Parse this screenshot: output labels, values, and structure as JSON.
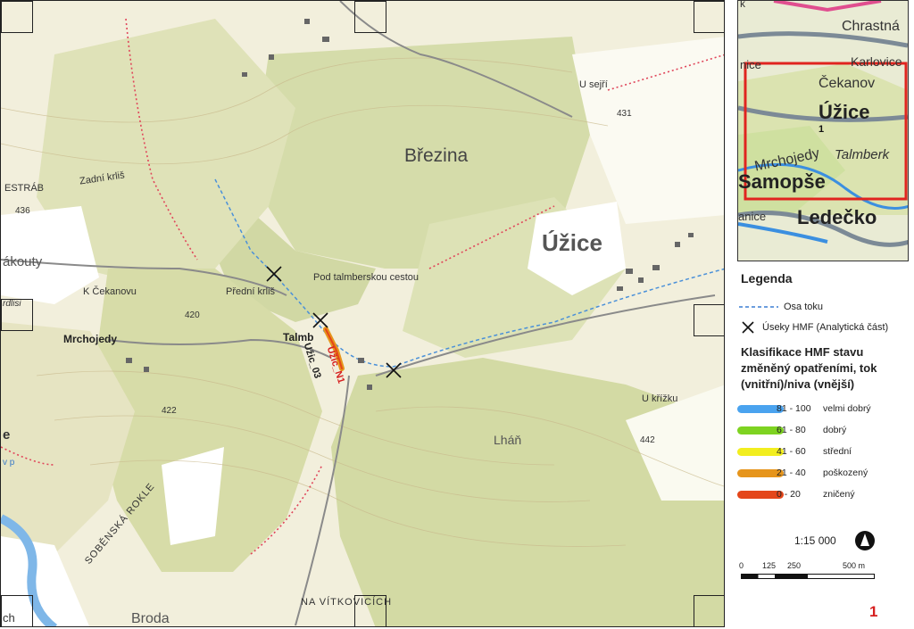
{
  "map": {
    "place_labels": {
      "brezina": "Březina",
      "uzice": "Úžice",
      "zadni_krlis": "Zadní krliš",
      "u_sejri": "U sejří",
      "pod_talmberskou": "Pod talmberskou cestou",
      "predni_krlis": "Přední krliš",
      "k_cekanovu": "K Čekanovu",
      "mrchojedy": "Mrchojedy",
      "talmb": "Talmb",
      "u_krizku": "U křížku",
      "lhan": "Lháň",
      "sobenska_rokle": "SOBĚNSKÁ ROKLE",
      "na_vitkovicich": "NA VÍTKOVICÍCH",
      "broda": "Broda",
      "estrab": "ESTRÁB",
      "akouty": "ákouty",
      "rdlisi": "rdlisi",
      "cekanov_top": "Čekanov",
      "e_left": "e",
      "ch_left": "ch",
      "v_p": "v p"
    },
    "spot_heights": {
      "h431": "431",
      "h436": "436",
      "h420": "420",
      "h422": "422",
      "h442": "442"
    },
    "segment_labels": {
      "uzic_n1": "Užic_N1",
      "uzic_03": "Užic_03"
    }
  },
  "inset": {
    "labels": {
      "chrastna": "Chrastná",
      "karlovice": "Karlovice",
      "cekanov": "Čekanov",
      "uzice": "Úžice",
      "one": "1",
      "talmberk": "Talmberk",
      "mrchojedy": "Mrchojedy",
      "samopse": "Samopše",
      "ledecko": "Ledečko",
      "nice": "nice",
      "k": "k",
      "anice": "anice"
    }
  },
  "legend": {
    "title": "Legenda",
    "osa_toku": "Osa toku",
    "useky": "Úseky HMF (Analytická část)",
    "class_title": "Klasifikace HMF stavu změněný opatřeními, tok (vnitřní)/niva (vnější)",
    "classes": [
      {
        "range": "81 - 100",
        "label": "velmi dobrý",
        "color": "#4aa3ef"
      },
      {
        "range": "61 - 80",
        "label": "dobrý",
        "color": "#7ed321"
      },
      {
        "range": "41 - 60",
        "label": "střední",
        "color": "#f2ee1f"
      },
      {
        "range": "21 - 40",
        "label": "poškozený",
        "color": "#e6951c"
      },
      {
        "range": "0 - 20",
        "label": "zničený",
        "color": "#e4461a"
      }
    ],
    "scale": "1:15 000",
    "scalebar_labels": [
      "0",
      "125",
      "250",
      "500 m"
    ],
    "page_number": "1"
  }
}
